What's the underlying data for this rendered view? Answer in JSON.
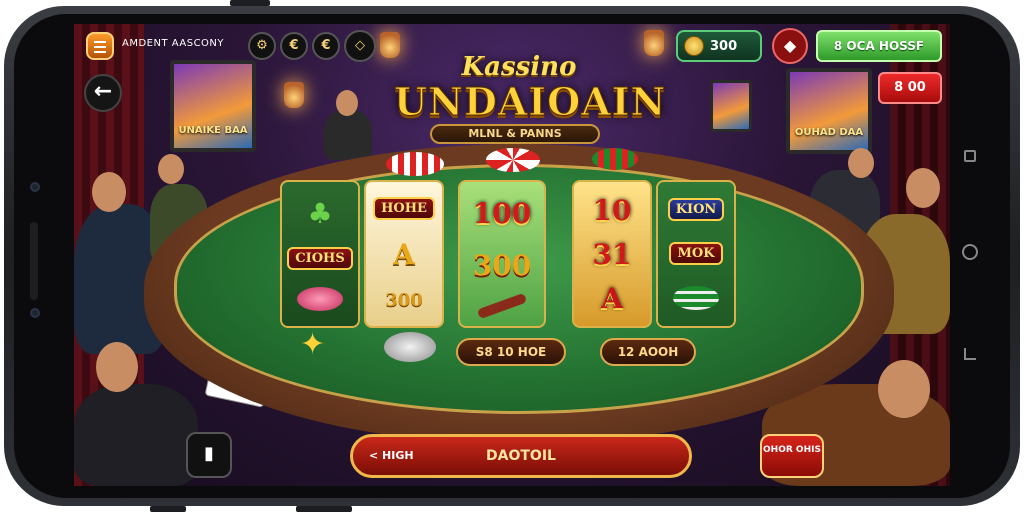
{
  "top_bar": {
    "brand": "AMDENT AASCONY",
    "icons": [
      "gear-icon",
      "coin-c-icon",
      "coin-c-icon",
      "gem-icon"
    ],
    "icon_glyphs": [
      "⚙",
      "€",
      "€",
      "◇"
    ],
    "coins": "300",
    "green_button": "8 OCA HOSSF",
    "red_badge": "8 00"
  },
  "title": {
    "top": "Kassino",
    "main": "UNDAIOAIN",
    "subtitle": "MLNL & PANNS"
  },
  "tv_left_label": "UNAIKE BAA",
  "tv_right_label": "OUHAD DAA",
  "reels": [
    {
      "symbols": [
        "♣",
        "CIOHS",
        ""
      ]
    },
    {
      "symbols": [
        "HOHE",
        "A",
        "300"
      ]
    },
    {
      "symbols": [
        "100",
        "300",
        ""
      ]
    },
    {
      "symbols": [
        "10",
        "31",
        "A"
      ]
    },
    {
      "symbols": [
        "KION",
        "MOK",
        ""
      ]
    }
  ],
  "pills": {
    "left": "S8 10 HOE",
    "right": "12 AOOH"
  },
  "bottom": {
    "left_icon": "cards-icon",
    "main_left": "< HIGH",
    "main_center": "DAOTOIL",
    "right": "OHOR OHIS"
  },
  "colors": {
    "felt": "#247232",
    "gold": "#ffd23a",
    "red": "#c9281a",
    "green": "#2e9a2a"
  }
}
